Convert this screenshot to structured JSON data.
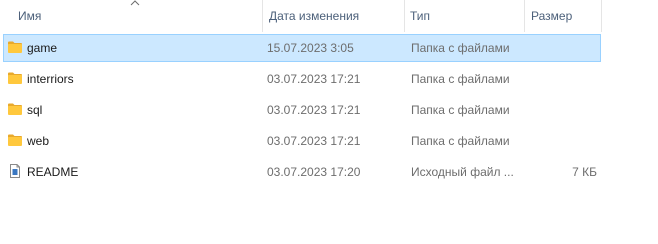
{
  "columns": {
    "name": "Имя",
    "date": "Дата изменения",
    "type": "Тип",
    "size": "Размер"
  },
  "sort": {
    "column": "name",
    "direction": "ascending",
    "icon": "sort-up-chevron-icon"
  },
  "colors": {
    "selection_bg": "#cce8ff",
    "selection_border": "#99d1ff",
    "folder_yellow": "#ffc83d",
    "header_text": "#4c607a"
  },
  "files": [
    {
      "name": "game",
      "date": "15.07.2023 3:05",
      "type": "Папка с файлами",
      "size": "",
      "icon": "folder-icon",
      "selected": true
    },
    {
      "name": "interriors",
      "date": "03.07.2023 17:21",
      "type": "Папка с файлами",
      "size": "",
      "icon": "folder-icon",
      "selected": false
    },
    {
      "name": "sql",
      "date": "03.07.2023 17:21",
      "type": "Папка с файлами",
      "size": "",
      "icon": "folder-icon",
      "selected": false
    },
    {
      "name": "web",
      "date": "03.07.2023 17:21",
      "type": "Папка с файлами",
      "size": "",
      "icon": "folder-icon",
      "selected": false
    },
    {
      "name": "README",
      "date": "03.07.2023 17:20",
      "type": "Исходный файл ...",
      "size": "7 КБ",
      "icon": "text-file-icon",
      "selected": false
    }
  ]
}
